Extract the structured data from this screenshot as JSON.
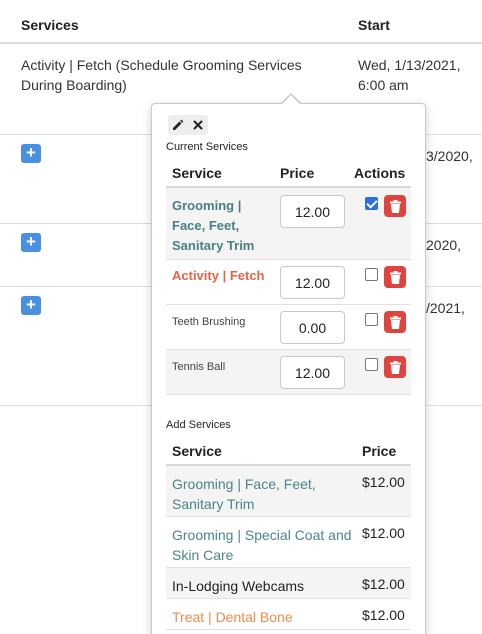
{
  "table": {
    "headers": {
      "services": "Services",
      "start": "Start"
    },
    "row1": {
      "service": "Activity | Fetch (Schedule Grooming Services During Boarding)",
      "start": "Wed, 1/13/2021, 6:00 am"
    },
    "row2": {
      "start_partial": "3/2020,"
    },
    "row3": {
      "start_partial": "2020,"
    },
    "row4": {
      "start_partial": "/2021,"
    },
    "add_glyph": "+"
  },
  "popover": {
    "current_label": "Current Services",
    "current_headers": {
      "service": "Service",
      "price": "Price",
      "actions": "Actions"
    },
    "current_services": [
      {
        "name": "Grooming | Face, Feet, Sanitary Trim",
        "price": "12.00",
        "checked": true
      },
      {
        "name": "Activity | Fetch",
        "price": "12.00",
        "checked": false
      },
      {
        "name": "Teeth Brushing",
        "price": "0.00",
        "checked": false
      },
      {
        "name": "Tennis Ball",
        "price": "12.00",
        "checked": false
      }
    ],
    "add_label": "Add Services",
    "add_headers": {
      "service": "Service",
      "price": "Price"
    },
    "add_services": [
      {
        "name": "Grooming | Face, Feet, Sanitary Trim",
        "price": "$12.00"
      },
      {
        "name": "Grooming | Special Coat and Skin Care",
        "price": "$12.00"
      },
      {
        "name": "In-Lodging Webcams",
        "price": "$12.00"
      },
      {
        "name": "Treat | Dental Bone",
        "price": "$12.00"
      }
    ]
  },
  "colors": {
    "plus_button": "#4a90e2",
    "grooming_text": "#4a7f82",
    "fetch_text": "#e2654a",
    "treat_text": "#f08a4b",
    "trash_button": "#e0443e",
    "checkbox_checked": "#2a72d9"
  },
  "icons": [
    "pencil-icon",
    "close-icon",
    "plus-icon",
    "trash-icon",
    "checkbox-icon"
  ]
}
